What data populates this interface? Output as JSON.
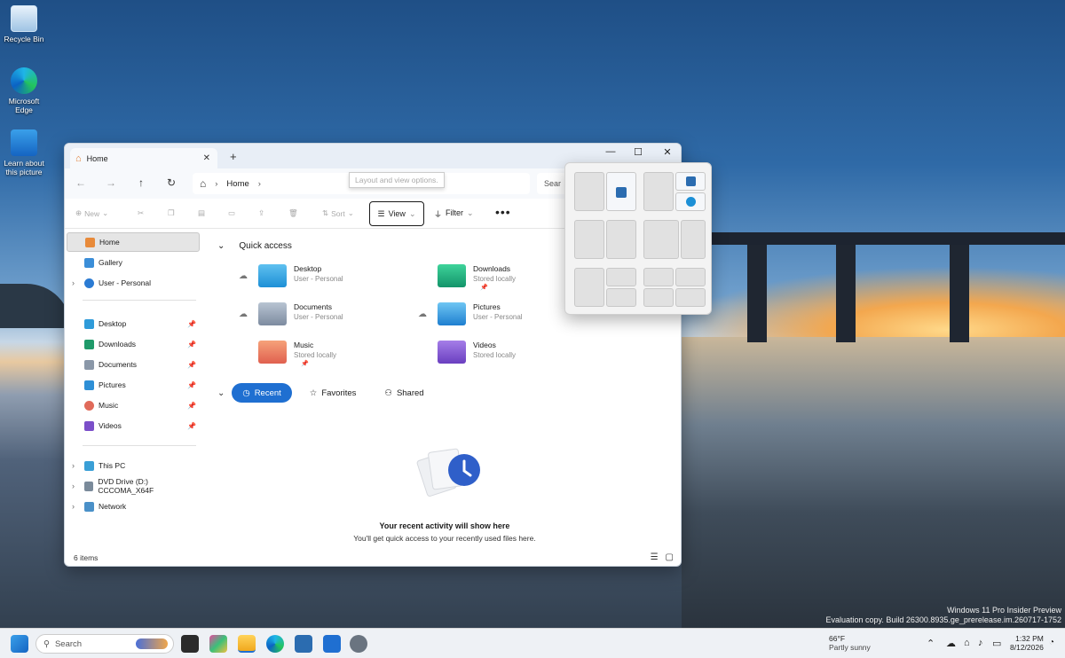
{
  "desktop": {
    "icons": [
      {
        "label": "Recycle Bin"
      },
      {
        "label": "Microsoft Edge"
      },
      {
        "label": "Learn about this picture"
      }
    ],
    "watermark": {
      "line1": "Windows 11 Pro Insider Preview",
      "line2": "Evaluation copy. Build 26300.8935.ge_prerelease.im.260717-1752"
    }
  },
  "explorer": {
    "tab_title": "Home",
    "breadcrumb": "Home",
    "search_placeholder": "Sear",
    "tooltip": "Layout and view options.",
    "commands": {
      "new": "New",
      "sort": "Sort",
      "view": "View",
      "filter": "Filter"
    },
    "sidebar": {
      "top": [
        {
          "label": "Home",
          "selected": true
        },
        {
          "label": "Gallery"
        },
        {
          "label": "User - Personal"
        }
      ],
      "pinned": [
        {
          "label": "Desktop"
        },
        {
          "label": "Downloads"
        },
        {
          "label": "Documents"
        },
        {
          "label": "Pictures"
        },
        {
          "label": "Music"
        },
        {
          "label": "Videos"
        }
      ],
      "devices": [
        {
          "label": "This PC"
        },
        {
          "label": "DVD Drive (D:) CCCOMA_X64F"
        },
        {
          "label": "Network"
        }
      ]
    },
    "quick_access": {
      "title": "Quick access",
      "items": [
        {
          "name": "Desktop",
          "sub": "User - Personal"
        },
        {
          "name": "Downloads",
          "sub": "Stored locally"
        },
        {
          "name": "Documents",
          "sub": "User - Personal"
        },
        {
          "name": "Pictures",
          "sub": "User - Personal"
        },
        {
          "name": "Music",
          "sub": "Stored locally"
        },
        {
          "name": "Videos",
          "sub": "Stored locally"
        }
      ]
    },
    "pills": {
      "recent": "Recent",
      "favorites": "Favorites",
      "shared": "Shared"
    },
    "empty": {
      "title": "Your recent activity will show here",
      "subtitle": "You'll get quick access to your recently used files here."
    },
    "status": "6 items"
  },
  "taskbar": {
    "search_placeholder": "Search",
    "weather_temp": "66°F",
    "weather_desc": "Partly sunny",
    "time": "1:32 PM",
    "date": "8/12/2026"
  },
  "colors": {
    "accent": "#1f6fd1",
    "window_bg": "#ffffff",
    "titlebar_bg": "#e8eef6"
  }
}
